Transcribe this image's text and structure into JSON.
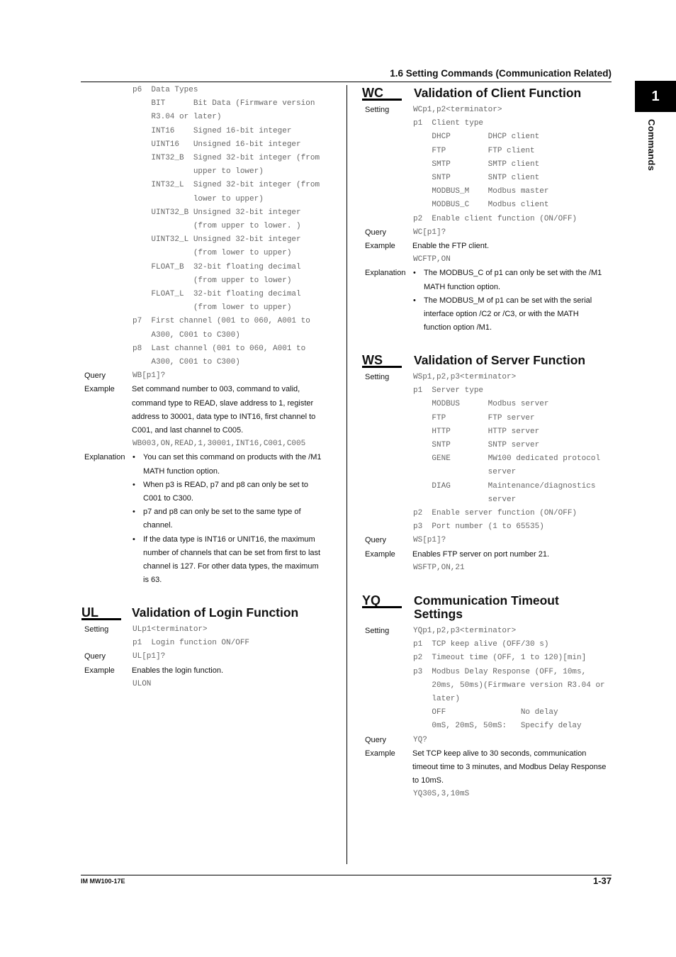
{
  "header": {
    "section_title": "1.6  Setting Commands (Communication Related)"
  },
  "tab": {
    "chapter_number": "1",
    "chapter_label": "Commands"
  },
  "footer": {
    "manual_id": "IM MW100-17E",
    "page_number": "1-37"
  },
  "left_top": {
    "rows": [
      {
        "k": "m",
        "t": "p6  Data Types"
      },
      {
        "k": "m",
        "t": "    BIT      Bit Data (Firmware version"
      },
      {
        "k": "m",
        "t": "    R3.04 or later)"
      },
      {
        "k": "m",
        "t": "    INT16    Signed 16-bit integer"
      },
      {
        "k": "m",
        "t": "    UINT16   Unsigned 16-bit integer"
      },
      {
        "k": "m",
        "t": "    INT32_B  Signed 32-bit integer (from"
      },
      {
        "k": "m",
        "t": "             upper to lower)"
      },
      {
        "k": "m",
        "t": "    INT32_L  Signed 32-bit integer (from"
      },
      {
        "k": "m",
        "t": "             lower to upper)"
      },
      {
        "k": "m",
        "t": "    UINT32_B Unsigned 32-bit integer"
      },
      {
        "k": "m",
        "t": "             (from upper to lower. )"
      },
      {
        "k": "m",
        "t": "    UINT32_L Unsigned 32-bit integer"
      },
      {
        "k": "m",
        "t": "             (from lower to upper)"
      },
      {
        "k": "m",
        "t": "    FLOAT_B  32-bit floating decimal"
      },
      {
        "k": "m",
        "t": "             (from upper to lower)"
      },
      {
        "k": "m",
        "t": "    FLOAT_L  32-bit floating decimal"
      },
      {
        "k": "m",
        "t": "             (from lower to upper)"
      },
      {
        "k": "m",
        "t": "p7  First channel (001 to 060, A001 to"
      },
      {
        "k": "m",
        "t": "    A300, C001 to C300)"
      },
      {
        "k": "m",
        "t": "p8  Last channel (001 to 060, A001 to"
      },
      {
        "k": "m",
        "t": "    A300, C001 to C300)"
      },
      {
        "k": "m",
        "l": "Query",
        "t": "WB[p1]?"
      },
      {
        "k": "s",
        "l": "Example",
        "t": "Set command number to 003, command to valid,"
      },
      {
        "k": "s",
        "t": "command type to READ, slave address to 1, register"
      },
      {
        "k": "s",
        "t": "address to 30001, data type to INT16, first channel to"
      },
      {
        "k": "s",
        "t": "C001, and last channel to C005."
      },
      {
        "k": "m",
        "t": "WB003,ON,READ,1,30001,INT16,C001,C005"
      },
      {
        "k": "b",
        "l": "Explanation",
        "t": "You can set this command on products with the /M1"
      },
      {
        "k": "c",
        "t": "MATH function option."
      },
      {
        "k": "b",
        "t": "When p3 is READ, p7 and p8 can only be set to"
      },
      {
        "k": "c",
        "t": "C001 to C300."
      },
      {
        "k": "b",
        "t": "p7 and p8 can only be set to the same type of"
      },
      {
        "k": "c",
        "t": "channel."
      },
      {
        "k": "b",
        "t": "If the data type is INT16 or UNIT16, the maximum"
      },
      {
        "k": "c",
        "t": "number of channels that can be set from first to last"
      },
      {
        "k": "c",
        "t": "channel is 127. For other data types, the maximum"
      },
      {
        "k": "c",
        "t": "is 63."
      }
    ]
  },
  "ul": {
    "code": "UL",
    "title": "Validation of Login Function",
    "rows": [
      {
        "k": "m",
        "l": "Setting",
        "t": "ULp1<terminator>"
      },
      {
        "k": "m",
        "t": "p1  Login function ON/OFF"
      },
      {
        "k": "m",
        "l": "Query",
        "t": "UL[p1]?"
      },
      {
        "k": "s",
        "l": "Example",
        "t": "Enables the login function."
      },
      {
        "k": "m",
        "t": "ULON"
      }
    ]
  },
  "wc": {
    "code": "WC",
    "title": "Validation of Client Function",
    "rows": [
      {
        "k": "m",
        "l": "Setting",
        "t": "WCp1,p2<terminator>"
      },
      {
        "k": "m",
        "t": "p1  Client type"
      },
      {
        "k": "m",
        "t": "    DHCP        DHCP client"
      },
      {
        "k": "m",
        "t": "    FTP         FTP client"
      },
      {
        "k": "m",
        "t": "    SMTP        SMTP client"
      },
      {
        "k": "m",
        "t": "    SNTP        SNTP client"
      },
      {
        "k": "m",
        "t": "    MODBUS_M    Modbus master"
      },
      {
        "k": "m",
        "t": "    MODBUS_C    Modbus client"
      },
      {
        "k": "m",
        "t": "p2  Enable client function (ON/OFF)"
      },
      {
        "k": "m",
        "l": "Query",
        "t": "WC[p1]?"
      },
      {
        "k": "s",
        "l": "Example",
        "t": "Enable the FTP client."
      },
      {
        "k": "m",
        "t": "WCFTP,ON"
      },
      {
        "k": "b",
        "l": "Explanation",
        "t": "The MODBUS_C of p1 can only be set with the /M1"
      },
      {
        "k": "c",
        "t": "MATH function option."
      },
      {
        "k": "b",
        "t": "The MODBUS_M of p1 can be set with the serial"
      },
      {
        "k": "c",
        "t": "interface option /C2 or /C3, or with the MATH"
      },
      {
        "k": "c",
        "t": "function option /M1."
      }
    ]
  },
  "ws": {
    "code": "WS",
    "title": "Validation of Server Function",
    "rows": [
      {
        "k": "m",
        "l": "Setting",
        "t": "WSp1,p2,p3<terminator>"
      },
      {
        "k": "m",
        "t": "p1  Server type"
      },
      {
        "k": "m",
        "t": "    MODBUS      Modbus server"
      },
      {
        "k": "m",
        "t": "    FTP         FTP server"
      },
      {
        "k": "m",
        "t": "    HTTP        HTTP server"
      },
      {
        "k": "m",
        "t": "    SNTP        SNTP server"
      },
      {
        "k": "m",
        "t": "    GENE        MW100 dedicated protocol"
      },
      {
        "k": "m",
        "t": "                server"
      },
      {
        "k": "m",
        "t": "    DIAG        Maintenance/diagnostics"
      },
      {
        "k": "m",
        "t": "                server"
      },
      {
        "k": "m",
        "t": "p2  Enable server function (ON/OFF)"
      },
      {
        "k": "m",
        "t": "p3  Port number (1 to 65535)"
      },
      {
        "k": "m",
        "l": "Query",
        "t": "WS[p1]?"
      },
      {
        "k": "s",
        "l": "Example",
        "t": "Enables FTP server on port number 21."
      },
      {
        "k": "m",
        "t": "WSFTP,ON,21"
      }
    ]
  },
  "yq": {
    "code": "YQ",
    "title": "Communication Timeout",
    "title2": "Settings",
    "rows": [
      {
        "k": "m",
        "l": "Setting",
        "t": "YQp1,p2,p3<terminator>"
      },
      {
        "k": "m",
        "t": "p1  TCP keep alive (OFF/30 s)"
      },
      {
        "k": "m",
        "t": "p2  Timeout time (OFF, 1 to 120)[min]"
      },
      {
        "k": "m",
        "t": "p3  Modbus Delay Response (OFF, 10ms,"
      },
      {
        "k": "m",
        "t": "    20ms, 50ms)(Firmware version R3.04 or"
      },
      {
        "k": "m",
        "t": "    later)"
      },
      {
        "k": "m",
        "t": "    OFF                No delay"
      },
      {
        "k": "m",
        "t": "    0mS, 20mS, 50mS:   Specify delay"
      },
      {
        "k": "m",
        "l": "Query",
        "t": "YQ?"
      },
      {
        "k": "s",
        "l": "Example",
        "t": "Set TCP keep alive to 30 seconds, communication"
      },
      {
        "k": "s",
        "t": "timeout time to 3 minutes, and Modbus Delay Response"
      },
      {
        "k": "s",
        "t": "to 10mS."
      },
      {
        "k": "m",
        "t": "YQ30S,3,10mS"
      }
    ]
  }
}
